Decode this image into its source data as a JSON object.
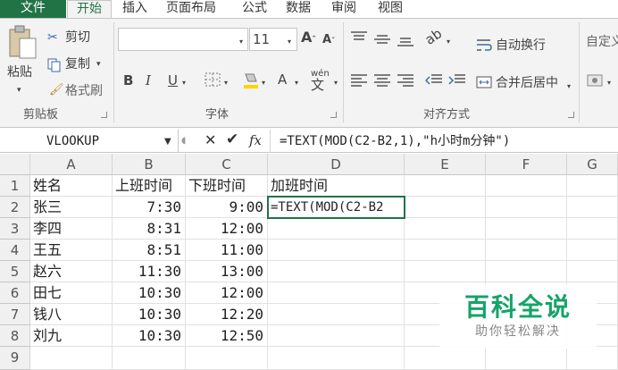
{
  "menu": {
    "tabs": [
      "文件",
      "开始",
      "插入",
      "页面布局",
      "公式",
      "数据",
      "审阅",
      "视图"
    ]
  },
  "ribbon": {
    "clipboard": {
      "paste": "粘贴",
      "cut": "剪切",
      "copy": "复制",
      "format_painter": "格式刷",
      "label": "剪贴板"
    },
    "font": {
      "size": "11",
      "bold": "B",
      "italic": "I",
      "underline": "U",
      "label": "字体"
    },
    "alignment": {
      "wrap_text": "自动换行",
      "merge_center": "合并后居中",
      "label": "对齐方式"
    },
    "number": {
      "format": "自定义"
    }
  },
  "formula_bar": {
    "name_box": "VLOOKUP",
    "fx": "fx",
    "formula": "=TEXT(MOD(C2-B2,1),\"h小时m分钟\")"
  },
  "grid": {
    "columns": [
      "A",
      "B",
      "C",
      "D",
      "E",
      "F",
      "G"
    ],
    "rows": [
      "1",
      "2",
      "3",
      "4",
      "5",
      "6",
      "7",
      "8",
      "9"
    ],
    "cells": [
      [
        "姓名",
        "上班时间",
        "下班时间",
        "加班时间"
      ],
      [
        "张三",
        "7:30",
        "9:00",
        "=TEXT(MOD(C2-B2"
      ],
      [
        "李四",
        "8:31",
        "12:00",
        ""
      ],
      [
        "王五",
        "8:51",
        "11:00",
        ""
      ],
      [
        "赵六",
        "11:30",
        "13:00",
        ""
      ],
      [
        "田七",
        "10:30",
        "12:00",
        ""
      ],
      [
        "钱八",
        "10:30",
        "12:20",
        ""
      ],
      [
        "刘九",
        "10:30",
        "12:50",
        ""
      ]
    ]
  },
  "watermark": {
    "title": "百科全说",
    "subtitle": "助你轻松解决"
  },
  "colors": {
    "excel_green": "#217346",
    "watermark_green": "#15a368"
  }
}
